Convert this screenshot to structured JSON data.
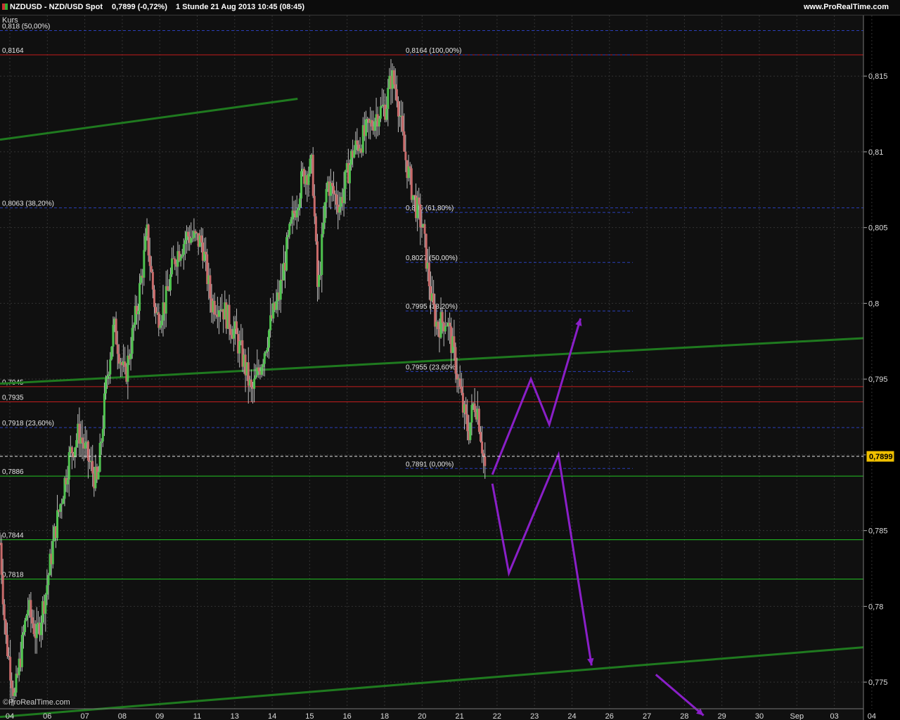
{
  "window": {
    "symbol": "NZDUSD - NZD/USD Spot",
    "quote": "0,7899 (-0,72%)",
    "interval_date": "1 Stunde  21 Aug 2013 10:45 (08:45)",
    "brand": "www.ProRealTime.com"
  },
  "chart_data": {
    "type": "candlestick",
    "title": "NZDUSD - NZD/USD Spot",
    "panel_label": "Kurs",
    "watermark": "©ProRealTime.com",
    "interval": "1 Stunde",
    "ylim": [
      0.7725,
      0.819
    ],
    "y_ticks": [
      "0,815",
      "0,81",
      "0,805",
      "0,8",
      "0,795",
      "0,79",
      "0,785",
      "0,78",
      "0,775"
    ],
    "y_tick_values": [
      0.815,
      0.81,
      0.805,
      0.8,
      0.795,
      0.79,
      0.785,
      0.78,
      0.775
    ],
    "x_ticks": [
      "04",
      "06",
      "07",
      "08",
      "09",
      "11",
      "13",
      "14",
      "15",
      "16",
      "18",
      "20",
      "21",
      "22",
      "23",
      "24",
      "26",
      "27",
      "28",
      "29",
      "30",
      "Sep",
      "03",
      "04"
    ],
    "last_price": {
      "label": "0,7899",
      "value": 0.7899
    },
    "price_path": [
      [
        0.0,
        0.7842
      ],
      [
        0.3,
        0.778
      ],
      [
        0.8,
        0.774
      ],
      [
        1.5,
        0.78
      ],
      [
        2.0,
        0.778
      ],
      [
        2.5,
        0.781
      ],
      [
        3.0,
        0.785
      ],
      [
        3.8,
        0.79
      ],
      [
        4.3,
        0.7915
      ],
      [
        5.0,
        0.789
      ],
      [
        5.3,
        0.788
      ],
      [
        5.8,
        0.795
      ],
      [
        6.2,
        0.7985
      ],
      [
        6.8,
        0.795
      ],
      [
        7.5,
        0.8
      ],
      [
        8.0,
        0.8045
      ],
      [
        8.5,
        0.799
      ],
      [
        9.0,
        0.8
      ],
      [
        9.5,
        0.803
      ],
      [
        10.2,
        0.8045
      ],
      [
        11.0,
        0.804
      ],
      [
        11.5,
        0.8
      ],
      [
        12.0,
        0.8
      ],
      [
        12.8,
        0.798
      ],
      [
        13.3,
        0.796
      ],
      [
        13.7,
        0.794
      ],
      [
        14.3,
        0.7965
      ],
      [
        14.8,
        0.799
      ],
      [
        15.2,
        0.8005
      ],
      [
        15.6,
        0.8035
      ],
      [
        16.0,
        0.806
      ],
      [
        16.5,
        0.8085
      ],
      [
        17.0,
        0.809
      ],
      [
        17.3,
        0.8005
      ],
      [
        17.8,
        0.808
      ],
      [
        18.5,
        0.8065
      ],
      [
        19.2,
        0.81
      ],
      [
        19.8,
        0.811
      ],
      [
        20.5,
        0.8125
      ],
      [
        21.0,
        0.813
      ],
      [
        21.3,
        0.815
      ],
      [
        21.6,
        0.814
      ],
      [
        22.0,
        0.81
      ],
      [
        22.5,
        0.807
      ],
      [
        23.0,
        0.805
      ],
      [
        23.5,
        0.8
      ],
      [
        23.8,
        0.7985
      ],
      [
        24.3,
        0.799
      ],
      [
        24.8,
        0.796
      ],
      [
        25.2,
        0.793
      ],
      [
        25.5,
        0.7915
      ],
      [
        25.8,
        0.7935
      ],
      [
        26.0,
        0.793
      ],
      [
        26.4,
        0.7891
      ]
    ],
    "x_range": [
      0,
      47
    ]
  },
  "levels": [
    {
      "label": "0,818 (50,00%)",
      "value": 0.818,
      "color": "#2a3fb8",
      "dashed": true
    },
    {
      "label": "0,8164",
      "value": 0.8164,
      "color": "#c21d1d",
      "dashed": false
    },
    {
      "label": "0,8063 (38,20%)",
      "value": 0.8063,
      "color": "#2a3fb8",
      "dashed": true
    },
    {
      "label": "0,7945",
      "value": 0.7945,
      "color": "#c21d1d",
      "dashed": false
    },
    {
      "label": "0,7935",
      "value": 0.7935,
      "color": "#c21d1d",
      "dashed": false
    },
    {
      "label": "0,7918 (23,60%)",
      "value": 0.7918,
      "color": "#2a3fb8",
      "dashed": true
    },
    {
      "label": "0,7886",
      "value": 0.7886,
      "color": "#23c423",
      "dashed": false
    },
    {
      "label": "0,7844",
      "value": 0.7844,
      "color": "#23c423",
      "dashed": false
    },
    {
      "label": "0,7818",
      "value": 0.7818,
      "color": "#23c423",
      "dashed": false
    }
  ],
  "fib_retracement": [
    {
      "label": "0,8164 (100,00%)",
      "value": 0.8164
    },
    {
      "label": "0,806 (61,80%)",
      "value": 0.806
    },
    {
      "label": "0,8027 (50,00%)",
      "value": 0.8027
    },
    {
      "label": "0,7995 (38,20%)",
      "value": 0.7995
    },
    {
      "label": "0,7955 (23,60%)",
      "value": 0.7955
    },
    {
      "label": "0,7891 (0,00%)",
      "value": 0.7891
    }
  ],
  "colors": {
    "background": "#000000",
    "grid": "#333333",
    "trendline": "#1f7a1f",
    "projection": "#8a1fc8",
    "last_price_tag": "#f0c000",
    "candle_up": "#4fc24f",
    "candle_down": "#c86a6a"
  }
}
